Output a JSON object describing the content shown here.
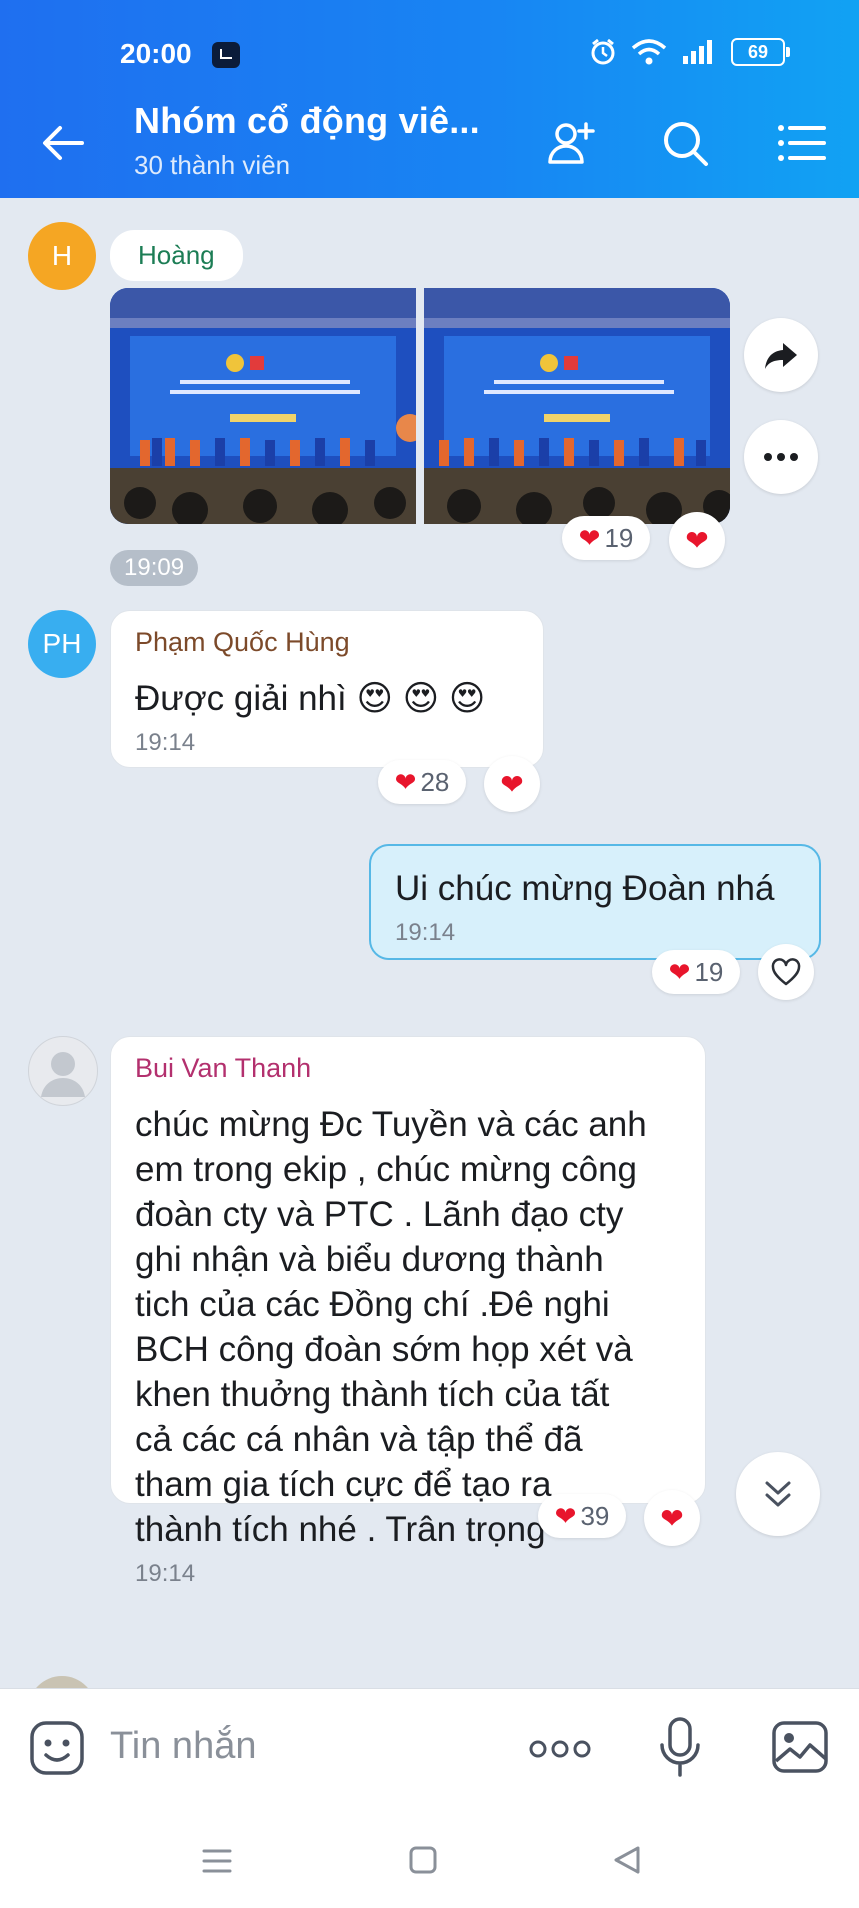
{
  "status": {
    "time": "20:00",
    "battery": "69"
  },
  "header": {
    "title": "Nhóm cổ động viê...",
    "subtitle": "30 thành viên"
  },
  "messages": {
    "hoang": {
      "avatar_initial": "H",
      "name": "Hoàng",
      "time": "19:09",
      "reaction_count": "19"
    },
    "hung": {
      "avatar_initial": "PH",
      "name": "Phạm Quốc Hùng",
      "text": "Được giải nhì 😍 😍 😍",
      "time": "19:14",
      "reaction_count": "28"
    },
    "mine": {
      "text": "Ui chúc mừng Đoàn nhá",
      "time": "19:14",
      "reaction_count": "19"
    },
    "thanh": {
      "name": "Bui Van Thanh",
      "lines": [
        "chúc mừng Đc Tuyền và các anh",
        "em trong ekip , chúc mừng công",
        "đoàn cty và PTC .  Lãnh đạo cty",
        "ghi nhận và biểu dương thành",
        "tich của các Đồng chí .Đê nghi",
        "BCH công đoàn sớm họp xét và",
        "khen thuởng thành tích của tất",
        "cả các cá nhân và tập thể đã",
        "tham gia tích cực để tạo ra",
        "thành tích nhé . Trân trọng"
      ],
      "time": "19:14",
      "reaction_count": "39"
    }
  },
  "input": {
    "placeholder": "Tin nhắn"
  },
  "colors": {
    "header_start": "#1f6ff0",
    "header_end": "#11a2f3",
    "chat_bg": "#e3e9f1",
    "mine_bubble": "#d7f0fb",
    "heart": "#e8152c"
  }
}
